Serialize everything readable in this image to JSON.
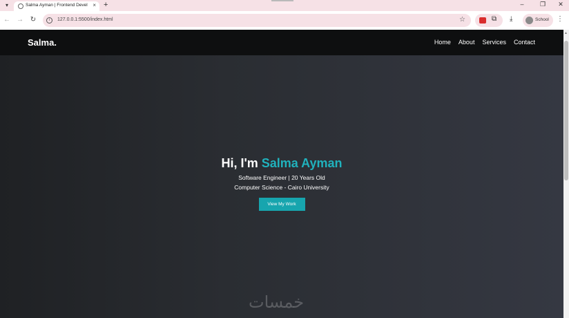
{
  "browser": {
    "tab_title": "Salma Ayman | Frontend Devel",
    "tab_close": "×",
    "new_tab": "+",
    "url": "127.0.0.1:5500/index.html",
    "profile_label": "School",
    "icons": {
      "tab_list": "▾",
      "back": "←",
      "forward": "→",
      "reload": "↻",
      "info": "i",
      "star": "☆",
      "puzzle": "⧉",
      "download": "⤓",
      "menu": "⋮",
      "minimize": "–",
      "restore": "❐",
      "close": "✕"
    }
  },
  "site": {
    "logo": "Salma",
    "logo_dot": ".",
    "nav": [
      "Home",
      "About",
      "Services",
      "Contact"
    ],
    "hero": {
      "greeting": "Hi, I'm ",
      "name": "Salma Ayman",
      "line1": "Software Engineer | 20 Years Old",
      "line2": "Computer Science - Cairo University",
      "cta": "View My Work"
    },
    "colors": {
      "accent": "#20b2bd",
      "button": "#17a5ae",
      "nav_bg": "#0e0f10"
    }
  },
  "watermark": "خمسات"
}
